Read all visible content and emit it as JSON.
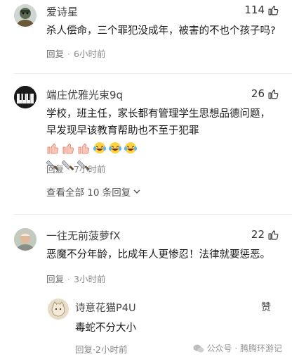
{
  "comments": [
    {
      "username": "爱诗星",
      "likes": "114",
      "text": "杀人偿命，三个罪犯没成年，被害的不也个孩子吗?",
      "reply_label": "回复",
      "time": "6小时前"
    },
    {
      "username": "端庄优雅光束9q",
      "likes": "26",
      "text": "学校，班主任，家长都有管理学生思想品德问题，早发现早该教育帮助也不至于犯罪",
      "emoji_line1": [
        "thumbs-up",
        "thumbs-up",
        "thumbs-up",
        "laugh-cry",
        "laugh-cry",
        "laugh-cry"
      ],
      "emoji_line2": [
        "cleaver",
        "cleaver",
        "cleaver"
      ],
      "reply_label": "回复",
      "time": "7小时前",
      "expand_label": "查看全部 10 条回复"
    },
    {
      "username": "一往无前菠萝fX",
      "likes": "22",
      "text": "恶魔不分年龄，比成年人更惨忍！法律就要惩恶。",
      "reply_label": "回复",
      "time": "3小时前",
      "sub_reply": {
        "username": "诗意花猫P4U",
        "like_label": "赞",
        "text": "毒蛇不分大小",
        "reply_label": "回复",
        "time": "2小时前"
      }
    }
  ],
  "watermark": {
    "text": "公众号 · 腾腾环游记"
  },
  "colors": {
    "meta": "#888888",
    "divider": "#ededed"
  }
}
